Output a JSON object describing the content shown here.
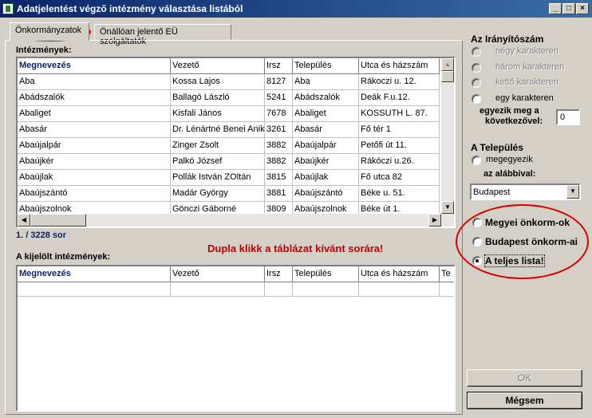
{
  "window": {
    "title": "Adatjelentést végző intézmény választása listából"
  },
  "tabs": [
    {
      "label": "Önkormányzatok",
      "active": true
    },
    {
      "label": "Önállóan jelentő EÜ szolgáltatók",
      "active": false
    }
  ],
  "institutions": {
    "label": "Intézmények:",
    "columns": [
      "Megnevezés",
      "Vezető",
      "Irsz",
      "Település",
      "Utca és házszám"
    ],
    "rows": [
      [
        "Aba",
        "Kossa Lajos",
        "8127",
        "Aba",
        "Rákoczi u. 12."
      ],
      [
        "Abádszalók",
        "Ballagó László",
        "5241",
        "Abádszalók",
        "Deák F.u.12."
      ],
      [
        "Abaliget",
        "Kisfali János",
        "7678",
        "Abaliget",
        "KOSSUTH L. 87."
      ],
      [
        "Abasár",
        "Dr. Lénártné Benei Anikó",
        "3261",
        "Abasár",
        "Fő tér 1"
      ],
      [
        "Abaújalpár",
        "Zinger Zsolt",
        "3882",
        "Abaújalpár",
        "Petőfi út 11."
      ],
      [
        "Abaújkér",
        "Palkó József",
        "3882",
        "Abaújkér",
        "Rákóczi u.26."
      ],
      [
        "Abaújlak",
        "Pollák István ZOltán",
        "3815",
        "Abaújlak",
        "Fő utca 82"
      ],
      [
        "Abaújszántó",
        "Madár György",
        "3881",
        "Abaújszántó",
        "Béke u. 51."
      ],
      [
        "Abaújszolnok",
        "Gönczi Gáborné",
        "3809",
        "Abaújszolnok",
        "Béke út 1."
      ]
    ],
    "counter": "1. / 3228 sor"
  },
  "hint": "Dupla klikk a táblázat kívánt sorára!",
  "selected": {
    "label": "A kijelölt intézmények:",
    "columns": [
      "Megnevezés",
      "Vezető",
      "Irsz",
      "Település",
      "Utca és házszám",
      "Te"
    ]
  },
  "zip": {
    "title": "Az Irányítószám",
    "options": [
      "négy karakteren",
      "három karakteren",
      "kettő karakteren",
      "egy karakteren"
    ],
    "match_label_1": "egyezik meg a",
    "match_label_2": "következővel:",
    "match_value": "0"
  },
  "settlement": {
    "title": "A Település",
    "option": "megegyezik",
    "below_label": "az alábbival:",
    "selected_value": "Budapest"
  },
  "scope": {
    "options": [
      "Megyei önkorm-ok",
      "Budapest önkorm-ai",
      "A teljes lista!"
    ],
    "selected_index": 2
  },
  "buttons": {
    "ok": "OK",
    "cancel": "Mégsem"
  },
  "colors": {
    "title_bar": "#0a246a",
    "hint_red": "#c00000",
    "annotation_red": "#d40000",
    "header_blue": "#0a246a"
  }
}
